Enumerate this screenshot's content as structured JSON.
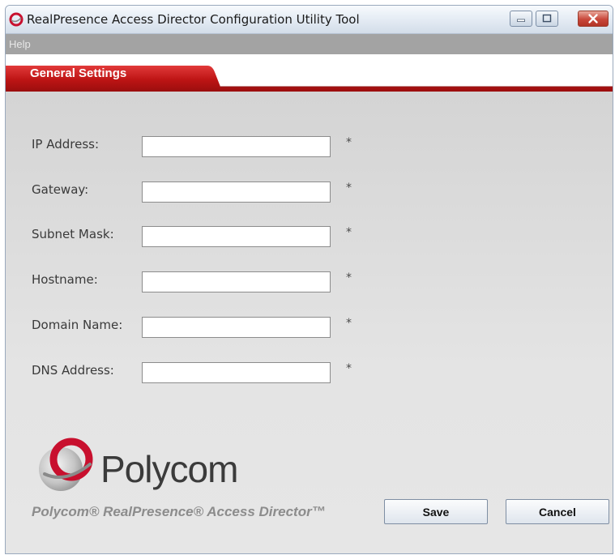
{
  "window": {
    "title": "RealPresence Access Director Configuration Utility Tool",
    "controls": [
      "minimize",
      "maximize",
      "close"
    ]
  },
  "menu": {
    "items": [
      {
        "label": "Help"
      }
    ]
  },
  "tabs": [
    {
      "label": "General Settings",
      "active": true
    }
  ],
  "form": {
    "required_marker": "*",
    "fields": [
      {
        "label": "IP Address:",
        "value": ""
      },
      {
        "label": "Gateway:",
        "value": ""
      },
      {
        "label": "Subnet Mask:",
        "value": ""
      },
      {
        "label": "Hostname:",
        "value": ""
      },
      {
        "label": "Domain Name:",
        "value": ""
      },
      {
        "label": "DNS Address:",
        "value": ""
      }
    ]
  },
  "branding": {
    "wordmark": "Polycom",
    "tagline": "Polycom® RealPresence® Access Director™",
    "brand_red": "#c8102e"
  },
  "buttons": {
    "save": "Save",
    "cancel": "Cancel"
  },
  "icons": [
    "polycom-app-icon",
    "minimize-icon",
    "maximize-icon",
    "close-icon",
    "polycom-logo-icon"
  ]
}
